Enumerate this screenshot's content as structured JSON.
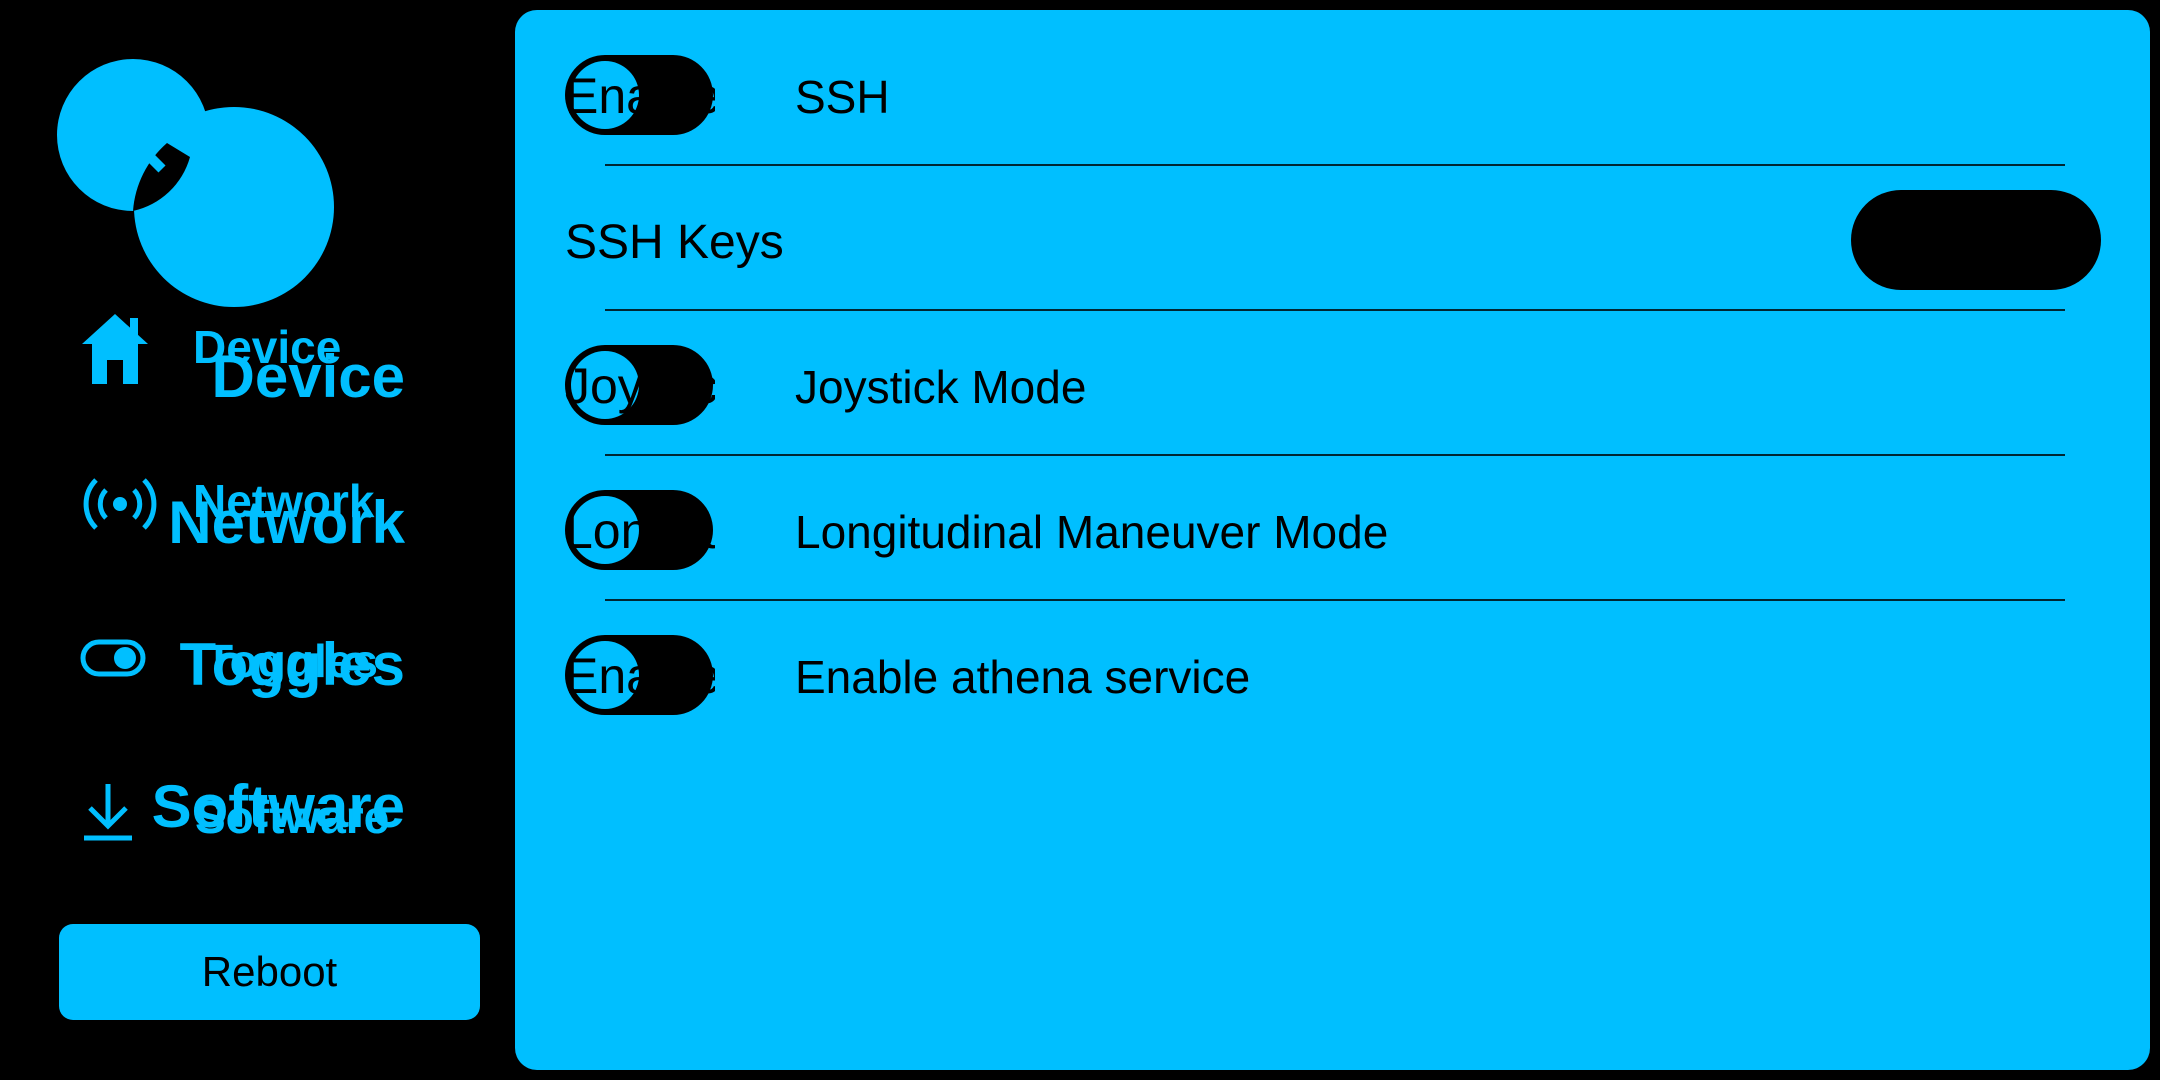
{
  "colors": {
    "background": "#000000",
    "accent": "#00BFFF",
    "text_on_accent": "#000000"
  },
  "sidebar": {
    "logo_icon": "two-circles-logo-icon",
    "items": [
      {
        "label": "Device",
        "icon": "home-icon"
      },
      {
        "label": "Network",
        "icon": "wifi-signal-icon"
      },
      {
        "label": "Toggles",
        "icon": "toggle-icon"
      },
      {
        "label": "Software",
        "icon": "download-icon"
      }
    ],
    "button_label": "Reboot"
  },
  "main": {
    "rows": [
      {
        "type": "toggle",
        "toggle_text": "Enable",
        "label": "SSH",
        "on": false
      },
      {
        "type": "button",
        "label": "SSH Keys",
        "button_label": ""
      },
      {
        "type": "toggle",
        "toggle_text": "Joystick",
        "label": "Joystick Mode",
        "on": false
      },
      {
        "type": "toggle",
        "toggle_text": "Longitudinal",
        "label": "Longitudinal Maneuver Mode",
        "on": false
      },
      {
        "type": "toggle",
        "toggle_text": "Enable",
        "label": "Enable athena service",
        "on": false
      }
    ]
  }
}
